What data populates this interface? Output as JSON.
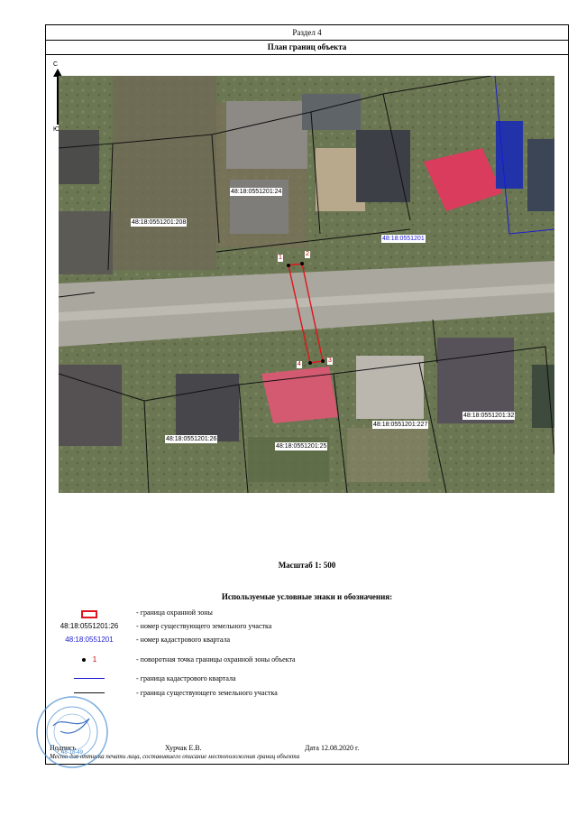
{
  "header": {
    "section": "Раздел 4",
    "title": "План границ объекта"
  },
  "compass": {
    "north": "С",
    "south": "Ю"
  },
  "map": {
    "parcel_labels": [
      "48:18:0551201:208",
      "48:18:0551201:24",
      "48:18:0551201:26",
      "48:18:0551201:25",
      "48:18:0551201:227",
      "48:18:0551201:32"
    ],
    "quarter_label": "48:18:0551201",
    "points": [
      "1",
      "2",
      "3",
      "4"
    ],
    "colors": {
      "zone_border": "#e0141b",
      "quarter_line": "#1a1ad0",
      "parcel_line": "#111111",
      "point": "#000000"
    }
  },
  "scale": "Масштаб 1: 500",
  "legend": {
    "title": "Используемые условные знаки и обозначения:",
    "items": [
      {
        "symbol": "",
        "text": "- граница  охранной зоны"
      },
      {
        "symbol": "48:18:0551201:26",
        "text": "- номер существующего земельного участка"
      },
      {
        "symbol": "48:18:0551201",
        "text": "- номер кадастрового квартала"
      },
      {
        "symbol": "1",
        "text": "- поворотная точка границы охранной зоны объекта"
      },
      {
        "symbol": "",
        "text": "- граница кадастрового квартала"
      },
      {
        "symbol": "",
        "text": "- граница существующего земельного участка"
      }
    ]
  },
  "signature": {
    "label": "Подпись",
    "name": "Хурчак Е.В.",
    "date": "Дата 12.08.2020 г.",
    "note": "Место для оттиска печати лица, составившего описание местоположения границ объекта",
    "stamp_text": "48-18-49"
  }
}
